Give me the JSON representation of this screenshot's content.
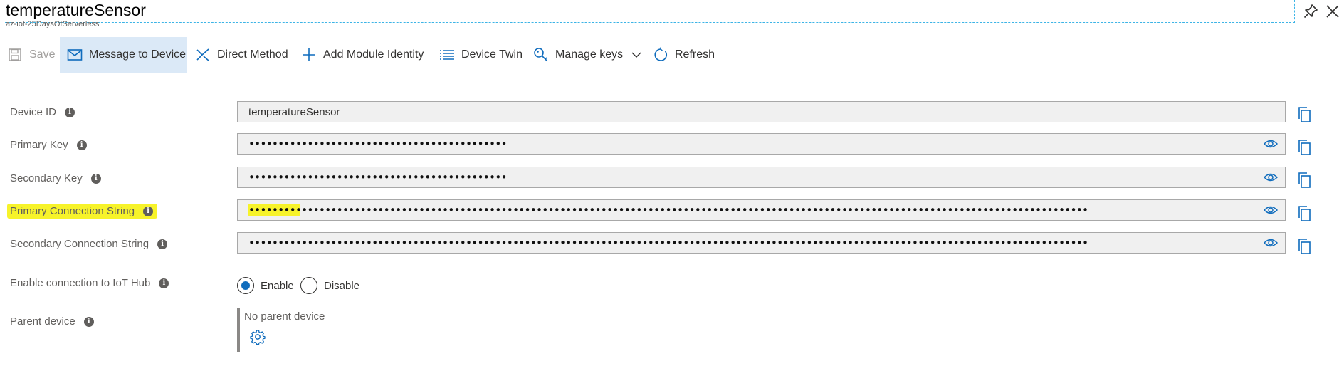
{
  "header": {
    "title": "temperatureSensor",
    "subtitle": "az-iot-25DaysOfServerless"
  },
  "toolbar": {
    "items": [
      {
        "label": "Save",
        "icon": "save-icon",
        "state": "disabled"
      },
      {
        "label": "Message to Device",
        "icon": "envelope-icon",
        "state": "active"
      },
      {
        "label": "Direct Method",
        "icon": "direct-method-icon"
      },
      {
        "label": "Add Module Identity",
        "icon": "plus-icon"
      },
      {
        "label": "Device Twin",
        "icon": "list-icon"
      },
      {
        "label": "Manage keys",
        "icon": "key-icon"
      },
      {
        "label": "Refresh",
        "icon": "refresh-icon"
      }
    ]
  },
  "form": {
    "device_id": {
      "label": "Device ID",
      "value": "temperatureSensor"
    },
    "primary_key": {
      "label": "Primary Key",
      "value": "••••••••••••••••••••••••••••••••••••••••••••"
    },
    "secondary_key": {
      "label": "Secondary Key",
      "value": "••••••••••••••••••••••••••••••••••••••••••••"
    },
    "primary_conn": {
      "label": "Primary Connection String",
      "value": "•••••••••••••••••••••••••••••••••••••••••••••••••••••••••••••••••••••••••••••••••••••••••••••••••••••••••••••••••••••••••••••••••••••••••••••••"
    },
    "secondary_conn": {
      "label": "Secondary Connection String",
      "value": "•••••••••••••••••••••••••••••••••••••••••••••••••••••••••••••••••••••••••••••••••••••••••••••••••••••••••••••••••••••••••••••••••••••••••••••••"
    },
    "connection": {
      "label": "Enable connection to IoT Hub",
      "enable": "Enable",
      "disable": "Disable",
      "selected": "Enable"
    },
    "parent": {
      "label": "Parent device",
      "value": "No parent device"
    }
  },
  "colors": {
    "accent": "#0f6cbd",
    "highlight": "#f7f32a",
    "active_bg": "#dbe9f7"
  }
}
